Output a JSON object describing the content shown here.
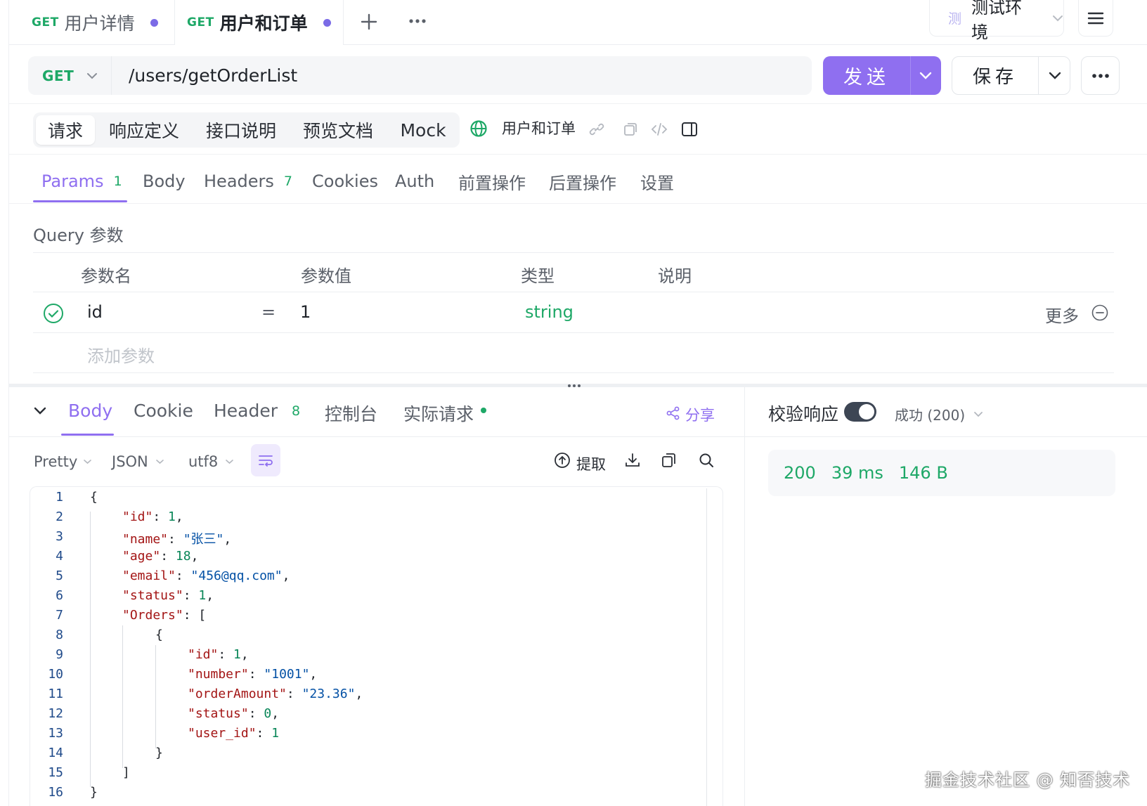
{
  "tabs": [
    {
      "method": "GET",
      "title": "用户详情"
    },
    {
      "method": "GET",
      "title": "用户和订单"
    }
  ],
  "environment": {
    "badge": "测",
    "label": "测试环境"
  },
  "request": {
    "method": "GET",
    "url": "/users/getOrderList",
    "send_label": "发送",
    "save_label": "保存"
  },
  "segments": [
    "请求",
    "响应定义",
    "接口说明",
    "预览文档",
    "Mock"
  ],
  "doc_name": "用户和订单",
  "param_tabs": {
    "params": "Params",
    "params_count": "1",
    "body": "Body",
    "headers": "Headers",
    "headers_count": "7",
    "cookies": "Cookies",
    "auth": "Auth",
    "pre": "前置操作",
    "post": "后置操作",
    "settings": "设置"
  },
  "query": {
    "title": "Query 参数",
    "columns": [
      "参数名",
      "参数值",
      "类型",
      "说明"
    ],
    "rows": [
      {
        "name": "id",
        "eq": "=",
        "value": "1",
        "type": "string",
        "more": "更多"
      }
    ],
    "add_placeholder": "添加参数"
  },
  "response_tabs": {
    "body": "Body",
    "cookie": "Cookie",
    "header": "Header",
    "header_count": "8",
    "console": "控制台",
    "actual": "实际请求",
    "share": "分享"
  },
  "verify": {
    "label": "校验响应",
    "enabled": true,
    "status": "成功 (200)"
  },
  "format": {
    "mode": "Pretty",
    "type": "JSON",
    "encoding": "utf8",
    "extract": "提取"
  },
  "summary": {
    "status": "200",
    "time": "39 ms",
    "size": "146 B"
  },
  "code_lines": [
    "1",
    "2",
    "3",
    "4",
    "5",
    "6",
    "7",
    "8",
    "9",
    "10",
    "11",
    "12",
    "13",
    "14",
    "15",
    "16"
  ],
  "json": {
    "id_key": "\"id\"",
    "id_val": "1",
    "name_key": "\"name\"",
    "name_val": "\"张三\"",
    "age_key": "\"age\"",
    "age_val": "18",
    "email_key": "\"email\"",
    "email_val": "\"456@qq.com\"",
    "status_key": "\"status\"",
    "status_val": "1",
    "orders_key": "\"Orders\"",
    "o_id_key": "\"id\"",
    "o_id_val": "1",
    "number_key": "\"number\"",
    "number_val": "\"1001\"",
    "amount_key": "\"orderAmount\"",
    "amount_val": "\"23.36\"",
    "o_status_key": "\"status\"",
    "o_status_val": "0",
    "user_key": "\"user_id\"",
    "user_val": "1"
  },
  "watermark": "掘金技术社区 @ 知否技术",
  "colors": {
    "accent": "#8f6ff0",
    "success": "#1ea867",
    "get": "#1ea867"
  }
}
